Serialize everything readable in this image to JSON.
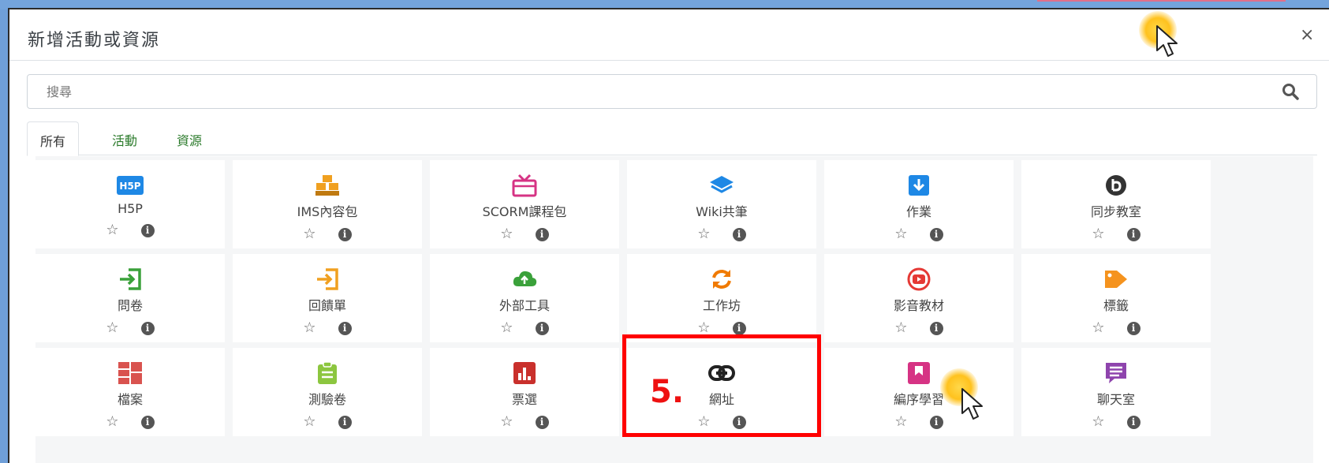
{
  "modal": {
    "title": "新增活動或資源",
    "close_label": "×"
  },
  "search": {
    "placeholder": "搜尋"
  },
  "tabs": [
    {
      "label": "所有",
      "active": true
    },
    {
      "label": "活動",
      "active": false
    },
    {
      "label": "資源",
      "active": false
    }
  ],
  "items": [
    {
      "label": "H5P",
      "icon": "h5p-icon",
      "color": "#1e88e5"
    },
    {
      "label": "IMS內容包",
      "icon": "package-boxes-icon",
      "color": "#f0a020"
    },
    {
      "label": "SCORM課程包",
      "icon": "gift-box-icon",
      "color": "#d63384"
    },
    {
      "label": "Wiki共筆",
      "icon": "layers-icon",
      "color": "#1e88e5"
    },
    {
      "label": "作業",
      "icon": "file-download-icon",
      "color": "#1e88e5"
    },
    {
      "label": "同步教室",
      "icon": "bigbluebutton-icon",
      "color": "#333333"
    },
    {
      "label": "問卷",
      "icon": "sign-in-icon",
      "color": "#3aa13a"
    },
    {
      "label": "回饋單",
      "icon": "sign-in-icon",
      "color": "#f0a020"
    },
    {
      "label": "外部工具",
      "icon": "cloud-upload-icon",
      "color": "#3aa13a"
    },
    {
      "label": "工作坊",
      "icon": "refresh-arrows-icon",
      "color": "#f07a00"
    },
    {
      "label": "影音教材",
      "icon": "youtube-play-icon",
      "color": "#e53935"
    },
    {
      "label": "標籤",
      "icon": "tag-icon",
      "color": "#f5931e"
    },
    {
      "label": "檔案",
      "icon": "file-grid-icon",
      "color": "#d9534f"
    },
    {
      "label": "測驗卷",
      "icon": "clipboard-icon",
      "color": "#8cc63f"
    },
    {
      "label": "票選",
      "icon": "bar-chart-icon",
      "color": "#c9302c"
    },
    {
      "label": "網址",
      "icon": "link-icon",
      "color": "#222222"
    },
    {
      "label": "編序學習",
      "icon": "bookmark-icon",
      "color": "#d63384"
    },
    {
      "label": "聊天室",
      "icon": "chat-icon",
      "color": "#8e44ad"
    }
  ],
  "actions": {
    "star": "☆",
    "info": "i"
  },
  "annotation": {
    "step": "5."
  }
}
